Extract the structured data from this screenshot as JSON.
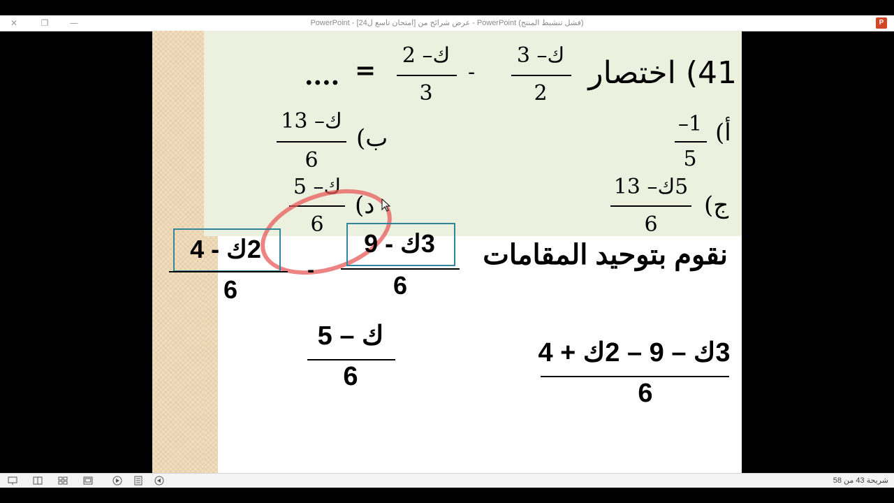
{
  "window": {
    "title": "PowerPoint - [امتحان تاسع ل24] عرض شرائح من - PowerPoint (فشل تنشيط المنتج)",
    "close_icon": "close-icon",
    "restore_icon": "restore-icon",
    "minimize_icon": "minimize-icon",
    "app_icon": "powerpoint-icon",
    "app_icon_letter": "P"
  },
  "slide": {
    "question": {
      "text": "41) اختصار",
      "frac1": {
        "num": "ك– 3",
        "den": "2"
      },
      "minus": "-",
      "frac2": {
        "num": "ك– 2",
        "den": "3"
      },
      "equals": "=",
      "ellipsis": "...."
    },
    "options": {
      "a": {
        "label": "أ)",
        "num": "–1",
        "den": "5"
      },
      "b": {
        "label": "ب)",
        "num": "ك– 13",
        "den": "6"
      },
      "c": {
        "label": "ج)",
        "num": "5ك– 13",
        "den": "6"
      },
      "d": {
        "label": "د)",
        "num": "ك– 5",
        "den": "6"
      }
    },
    "step1": {
      "heading": "نقوم بتوحيد المقامات",
      "frac_a": {
        "num": "3ك - 9",
        "den": "6"
      },
      "minus": "-",
      "frac_b": {
        "num": "2ك - 4",
        "den": "6"
      }
    },
    "step2": {
      "num": "3ك – 9 – 2ك + 4",
      "den": "6"
    },
    "result": {
      "num": "ك – 5",
      "den": "6"
    },
    "highlight_color": "#e85a5a",
    "box_color": "#31859c",
    "green_bg": "#ebf1de"
  },
  "statusbar": {
    "slide_counter": "شريحة 43 من 58",
    "buttons": [
      "slideshow-icon",
      "reading-view-icon",
      "slide-sorter-icon",
      "normal-view-icon",
      "play-icon",
      "notes-icon",
      "prev-icon"
    ]
  }
}
